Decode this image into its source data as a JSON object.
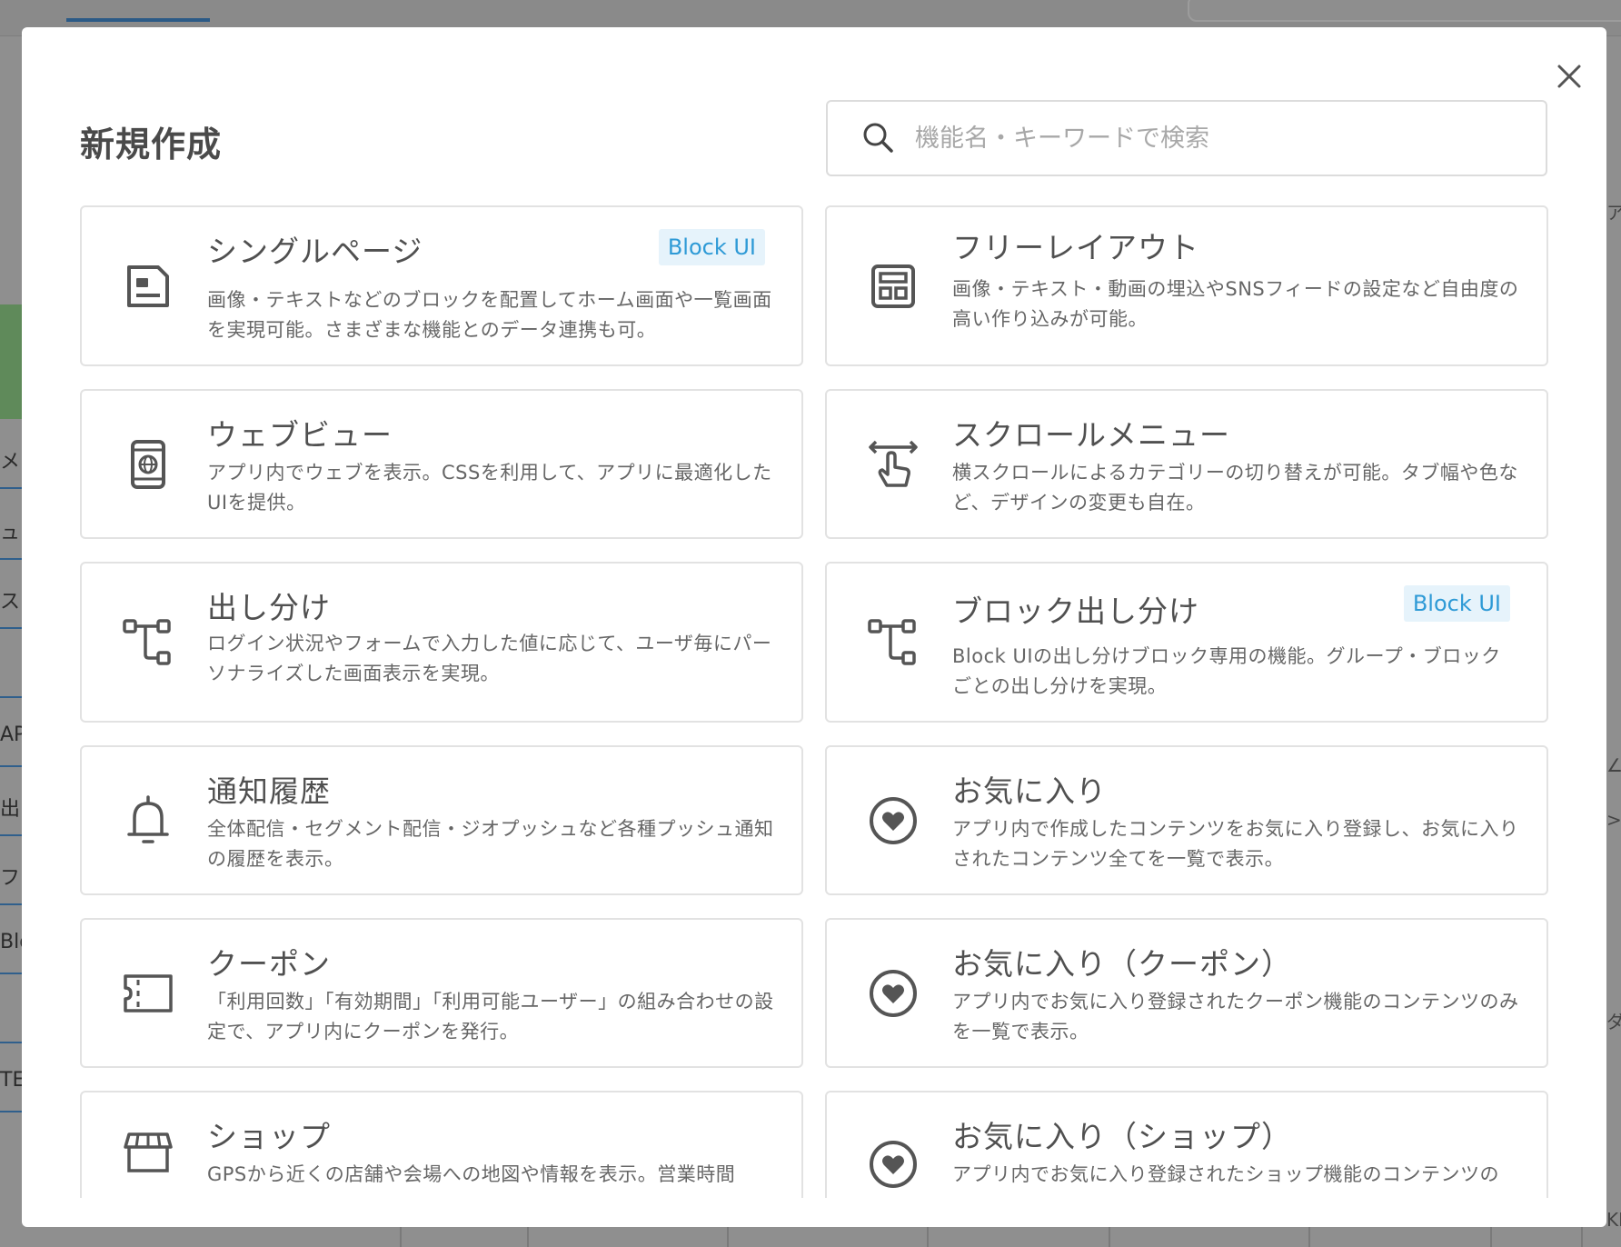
{
  "modal": {
    "title": "新規作成",
    "search": {
      "placeholder": "機能名・キーワードで検索",
      "value": ""
    },
    "badge_color": "#2e9ad6",
    "cards": [
      {
        "title": "シングルページ",
        "badge": "Block UI",
        "icon": "page-icon",
        "description": "画像・テキストなどのブロックを配置してホーム画面や一覧画面を実現可能。さまざまな機能とのデータ連携も可。"
      },
      {
        "title": "フリーレイアウト",
        "badge": "",
        "icon": "layout-icon",
        "description": "画像・テキスト・動画の埋込やSNSフィードの設定など自由度の高い作り込みが可能。"
      },
      {
        "title": "ウェブビュー",
        "badge": "",
        "icon": "webview-icon",
        "description": "アプリ内でウェブを表示。CSSを利用して、アプリに最適化したUIを提供。"
      },
      {
        "title": "スクロールメニュー",
        "badge": "",
        "icon": "swipe-icon",
        "description": "横スクロールによるカテゴリーの切り替えが可能。タブ幅や色など、デザインの変更も自在。"
      },
      {
        "title": "出し分け",
        "badge": "",
        "icon": "branch-icon",
        "description": "ログイン状況やフォームで入力した値に応じて、ユーザ毎にパーソナライズした画面表示を実現。"
      },
      {
        "title": "ブロック出し分け",
        "badge": "Block UI",
        "icon": "branch-icon",
        "description": "Block UIの出し分けブロック専用の機能。グループ・ブロックごとの出し分けを実現。"
      },
      {
        "title": "通知履歴",
        "badge": "",
        "icon": "bell-icon",
        "description": "全体配信・セグメント配信・ジオプッシュなど各種プッシュ通知の履歴を表示。"
      },
      {
        "title": "お気に入り",
        "badge": "",
        "icon": "heart-icon",
        "description": "アプリ内で作成したコンテンツをお気に入り登録し、お気に入りされたコンテンツ全てを一覧で表示。"
      },
      {
        "title": "クーポン",
        "badge": "",
        "icon": "coupon-icon",
        "description": "「利用回数」「有効期間」「利用可能ユーザー」の組み合わせの設定で、アプリ内にクーポンを発行。"
      },
      {
        "title": "お気に入り（クーポン）",
        "badge": "",
        "icon": "heart-icon",
        "description": "アプリ内でお気に入り登録されたクーポン機能のコンテンツのみを一覧で表示。"
      },
      {
        "title": "ショップ",
        "badge": "",
        "icon": "shop-icon",
        "description": "GPSから近くの店舗や会場への地図や情報を表示。営業時間"
      },
      {
        "title": "お気に入り（ショップ）",
        "badge": "",
        "icon": "heart-icon",
        "description": "アプリ内でお気に入り登録されたショップ機能のコンテンツの"
      }
    ]
  },
  "background": {
    "sidebar_fragments": [
      "メニ",
      "ュ",
      "スク",
      "",
      "AP",
      "出し",
      "フ",
      "Blo",
      "",
      "TE"
    ],
    "right_fragments": [
      "ア",
      "∠",
      ">",
      "ダ",
      "KE"
    ]
  }
}
